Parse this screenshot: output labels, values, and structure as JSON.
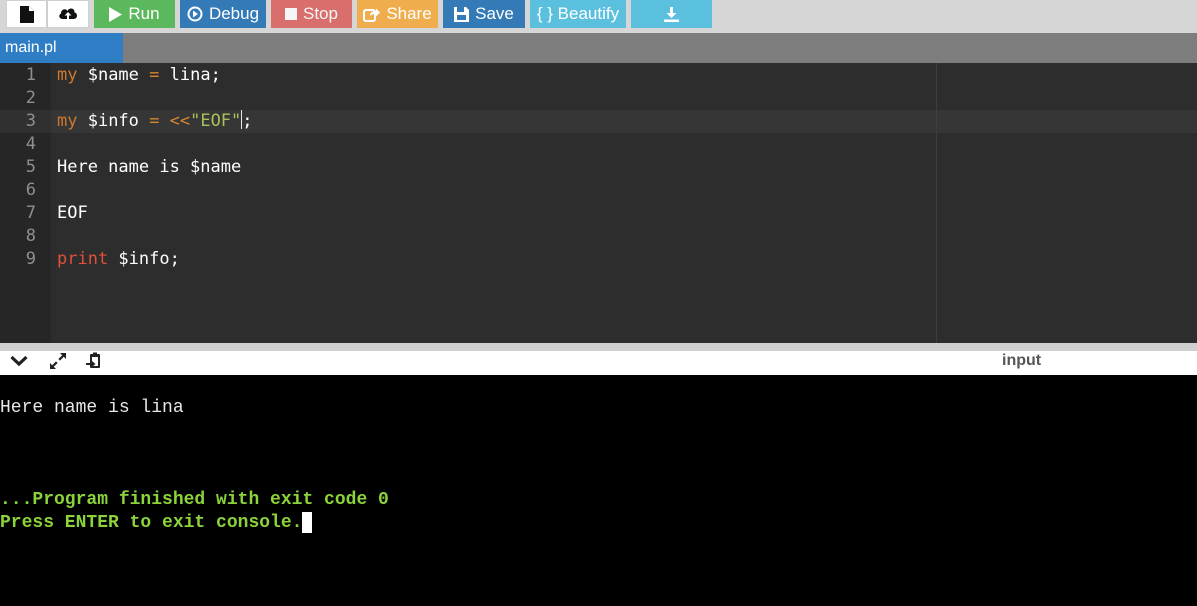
{
  "toolbar": {
    "run_label": "Run",
    "debug_label": "Debug",
    "stop_label": "Stop",
    "share_label": "Share",
    "save_label": "Save",
    "beautify_label": "{ } Beautify"
  },
  "colors": {
    "run": "#5cb85c",
    "debug": "#337ab7",
    "stop": "#d9534f",
    "share": "#f0ad4e",
    "save": "#337ab7",
    "beautify": "#5bc0de",
    "tab_active": "#2f7dc4",
    "editor_bg": "#2d2d2d",
    "console_bg": "#000000",
    "status_text": "#8bd33a"
  },
  "icons": {
    "new_file": "new-file-icon",
    "upload": "cloud-upload-icon",
    "run": "play-icon",
    "debug": "debug-circle-icon",
    "stop": "stop-square-icon",
    "share": "share-icon",
    "save": "floppy-disk-icon",
    "download": "download-icon",
    "collapse": "chevron-down-icon",
    "expand": "expand-arrows-icon",
    "paste": "clipboard-icon"
  },
  "tab": {
    "filename": "main.pl"
  },
  "editor": {
    "line_numbers": [
      "1",
      "2",
      "3",
      "4",
      "5",
      "6",
      "7",
      "8",
      "9"
    ],
    "line1": {
      "kw": "my",
      "a": " $name ",
      "op": "=",
      "b": " lina;"
    },
    "line3": {
      "kw": "my",
      "a": " $info ",
      "op": "= <<",
      "str": "\"EOF\"",
      "tail": ";"
    },
    "line5": "Here name is $name",
    "line7": "EOF",
    "line9": {
      "kw": "print",
      "rest": " $info;"
    }
  },
  "output_panel": {
    "input_label": "input"
  },
  "console": {
    "output_line": "Here name is lina",
    "finished_line": "...Program finished with exit code 0",
    "exit_prompt": "Press ENTER to exit console."
  }
}
